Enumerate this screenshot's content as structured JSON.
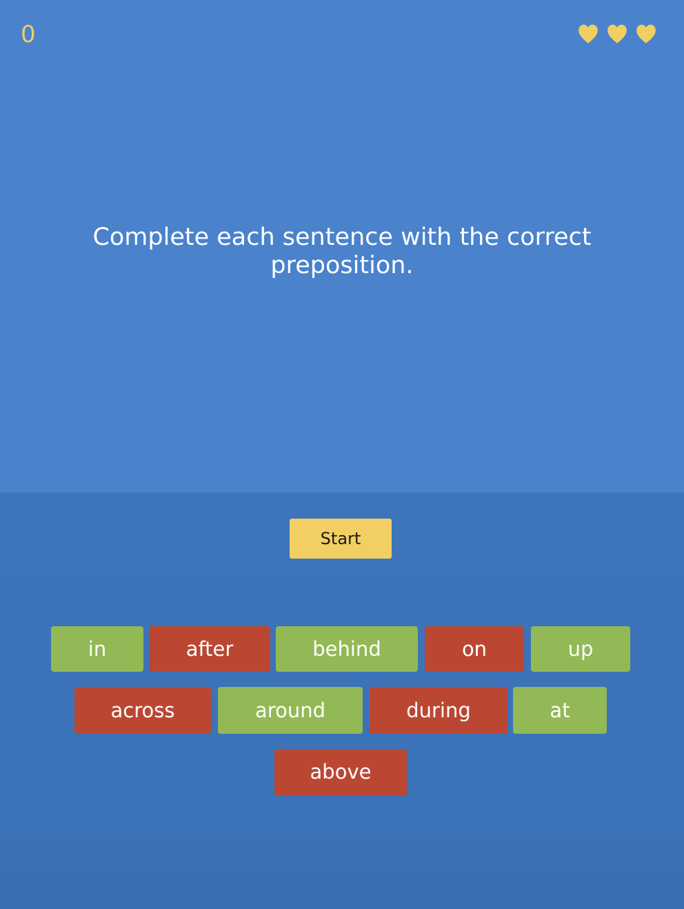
{
  "hud": {
    "score": "0",
    "lives": 3,
    "life_icon": "heart-icon",
    "life_color": "#f0cf62"
  },
  "prompt": "Complete each sentence with the correct preposition.",
  "start_label": "Start",
  "colors": {
    "top_background": "#4a82cc",
    "bottom_background": "#3c72b8",
    "start_button": "#f1cf62",
    "tile_green": "#92b955",
    "tile_red": "#bb4733"
  },
  "word_rows": [
    [
      {
        "word": "in",
        "color": "green"
      },
      {
        "word": "after",
        "color": "red"
      },
      {
        "word": "behind",
        "color": "green"
      },
      {
        "word": "on",
        "color": "red"
      },
      {
        "word": "up",
        "color": "green"
      }
    ],
    [
      {
        "word": "across",
        "color": "red"
      },
      {
        "word": "around",
        "color": "green"
      },
      {
        "word": "during",
        "color": "red"
      },
      {
        "word": "at",
        "color": "green"
      }
    ],
    [
      {
        "word": "above",
        "color": "red"
      }
    ]
  ]
}
